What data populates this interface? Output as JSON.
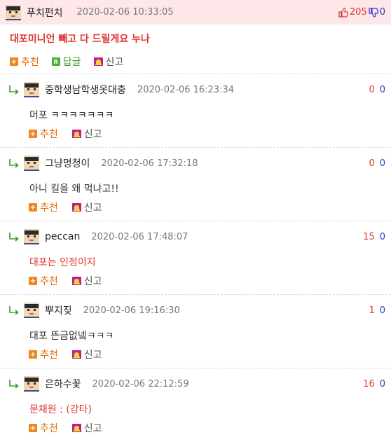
{
  "main": {
    "nickname": "푸치펀치",
    "date": "2020-02-06 10:33:05",
    "up": "205",
    "down": "0",
    "text": "대포미니언 빼고 다 드릴게요 누나",
    "recommend": "추천",
    "reply": "답글",
    "reply_icon": "R",
    "report": "신고"
  },
  "replies": [
    {
      "nickname": "중학생남학생옷대충",
      "date": "2020-02-06 16:23:34",
      "up": "0",
      "down": "0",
      "text": "머포 ㅋㅋㅋㅋㅋㅋㅋ",
      "recommend": "추천",
      "report": "신고",
      "text_color": "#333333"
    },
    {
      "nickname": "그냥멍청이",
      "date": "2020-02-06 17:32:18",
      "up": "0",
      "down": "0",
      "text": "아니 킬을 왜 먹냐고!!",
      "recommend": "추천",
      "report": "신고",
      "text_color": "#333333"
    },
    {
      "nickname": "peccan",
      "date": "2020-02-06 17:48:07",
      "up": "15",
      "down": "0",
      "text": "대포는 인정이지",
      "recommend": "추천",
      "report": "신고",
      "text_color": "#e0352b"
    },
    {
      "nickname": "뿌지짖",
      "date": "2020-02-06 19:16:30",
      "up": "1",
      "down": "0",
      "text": "대포 뜬금없넼ㅋㅋㅋ",
      "recommend": "추천",
      "report": "신고",
      "text_color": "#333333"
    },
    {
      "nickname": "은하수꽃",
      "date": "2020-02-06 22:12:59",
      "up": "16",
      "down": "0",
      "text": "문채원 : (강타)",
      "recommend": "추천",
      "report": "신고",
      "text_color": "#e0352b"
    }
  ],
  "colors": {
    "accent_red": "#e0352b",
    "down_blue": "#3333cc",
    "header_bg": "#fde7e8",
    "recommend_orange": "#f0861f",
    "reply_green": "#4caf37",
    "report_magenta": "#c01e8c"
  }
}
